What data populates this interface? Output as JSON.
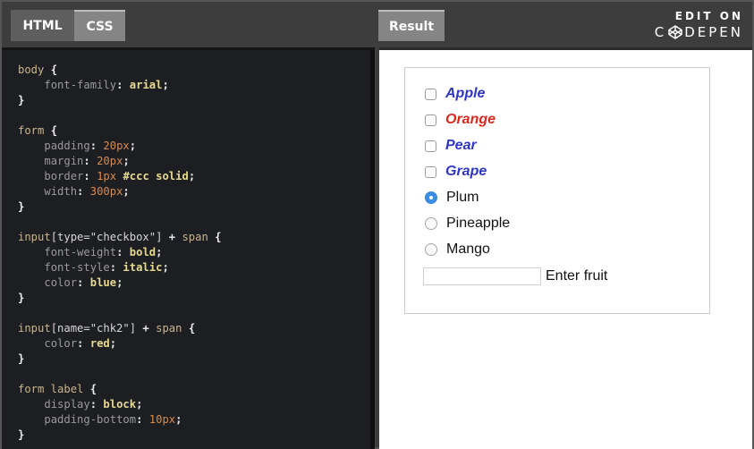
{
  "tabs": {
    "html": "HTML",
    "css": "CSS",
    "result": "Result"
  },
  "codepen": {
    "edit_on": "EDIT ON",
    "name_prefix": "C",
    "name_suffix": "DEPEN",
    "logo_icon": "codepen-logo-icon"
  },
  "code": {
    "b1_sel": "body",
    "b1_p1": "font-family",
    "b1_v1": "arial",
    "b2_sel": "form",
    "b2_p1": "padding",
    "b2_v1": "20px",
    "b2_p2": "margin",
    "b2_v2": "20px",
    "b2_p3": "border",
    "b2_v3a": "1px",
    "b2_v3b": "#ccc solid",
    "b2_p4": "width",
    "b2_v4": "300px",
    "b3_sel_a": "input",
    "b3_sel_b": "[type=\"checkbox\"]",
    "b3_sel_c": "span",
    "b3_p1": "font-weight",
    "b3_v1": "bold",
    "b3_p2": "font-style",
    "b3_v2": "italic",
    "b3_p3": "color",
    "b3_v3": "blue",
    "b4_sel_a": "input",
    "b4_sel_b": "[name=\"chk2\"]",
    "b4_sel_c": "span",
    "b4_p1": "color",
    "b4_v1": "red",
    "b5_sel": "form label",
    "b5_p1": "display",
    "b5_v1": "block",
    "b5_p2": "padding-bottom",
    "b5_v2": "10px"
  },
  "result": {
    "checkboxes": [
      {
        "label": "Apple",
        "checked": false,
        "color": "#2f36c4"
      },
      {
        "label": "Orange",
        "checked": false,
        "color": "#d8291f"
      },
      {
        "label": "Pear",
        "checked": false,
        "color": "#2f36c4"
      },
      {
        "label": "Grape",
        "checked": false,
        "color": "#2f36c4"
      }
    ],
    "radios": [
      {
        "label": "Plum",
        "checked": true
      },
      {
        "label": "Pineapple",
        "checked": false
      },
      {
        "label": "Mango",
        "checked": false
      }
    ],
    "text_input": {
      "value": "",
      "placeholder": ""
    },
    "text_input_label": "Enter fruit"
  }
}
